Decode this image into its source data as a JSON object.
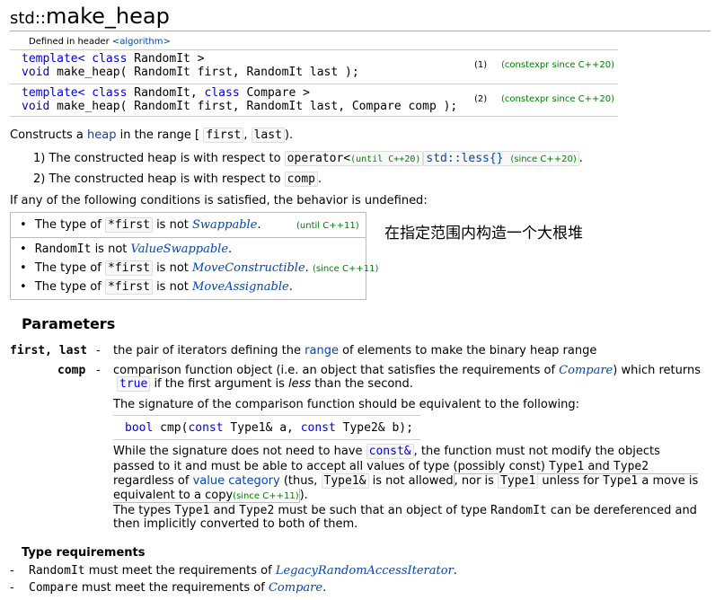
{
  "header": {
    "title_prefix": "std::",
    "title_main": "make_heap",
    "defined_in_prefix": "Defined in header ",
    "defined_in_header": "<algorithm>"
  },
  "decls": [
    {
      "tpl_kw": "template<",
      "tpl_class": "class",
      "tpl_rest": " RandomIt >",
      "ret_kw": "void",
      "sig": " make_heap( RandomIt first, RandomIt last );",
      "num": "(1)",
      "note": "(constexpr since C++20)"
    },
    {
      "tpl_kw": "template<",
      "tpl_class": "class",
      "tpl_mid": " RandomIt, ",
      "tpl_class2": "class",
      "tpl_rest": " Compare >",
      "ret_kw": "void",
      "sig": " make_heap( RandomIt first, RandomIt last, Compare comp );",
      "num": "(2)",
      "note": "(constexpr since C++20)"
    }
  ],
  "intro": {
    "prefix": "Constructs a ",
    "heap_link": "heap",
    "mid": " in the range [",
    "first": "first",
    "comma": ",",
    "last": "last",
    "suffix": ")."
  },
  "items": [
    {
      "label": "1) The constructed heap is with respect to ",
      "op": "operator<",
      "until": "(until C++20)",
      "less": "std::less{}",
      "since": "(since C++20)",
      "end": "."
    },
    {
      "label": "2) The constructed heap is with respect to ",
      "comp": "comp",
      "end": "."
    }
  ],
  "undefined_intro": "If any of the following conditions is satisfied, the behavior is undefined:",
  "conditions": {
    "c1_prefix": "The type of ",
    "c1_code": "*first",
    "c1_mid": " is not ",
    "c1_link": "Swappable",
    "c1_end": ".",
    "c1_note": "(until C++11)",
    "c2_code": "RandomIt",
    "c2_mid": " is not ",
    "c2_link": "ValueSwappable",
    "c2_end": ".",
    "c3_prefix": "The type of ",
    "c3_code": "*first",
    "c3_mid": " is not ",
    "c3_link": "MoveConstructible",
    "c3_end": ".",
    "c3_note": "(since C++11)",
    "c4_prefix": "The type of ",
    "c4_code": "*first",
    "c4_mid": " is not ",
    "c4_link": "MoveAssignable",
    "c4_end": "."
  },
  "annotation": "在指定范围内构造一个大根堆",
  "parameters": {
    "heading": "Parameters",
    "p1_name": "first, last",
    "dash": "-",
    "p1_prefix": "the pair of iterators defining the ",
    "p1_link": "range",
    "p1_suffix": " of elements to make the binary heap range",
    "p2_name": "comp",
    "p2_l1_prefix": "comparison function object (i.e. an object that satisfies the requirements of ",
    "p2_l1_link": "Compare",
    "p2_l1_suffix": ") which returns",
    "p2_l2_true": "true",
    "p2_l2_mid": " if the first argument is ",
    "p2_l2_less": "less",
    "p2_l2_end": " than the second.",
    "sig_intro": "The signature of the comparison function should be equivalent to the following:",
    "sig_kw_bool": "bool",
    "sig_cmp": " cmp(",
    "sig_kw_const1": "const",
    "sig_t1": " Type1& a, ",
    "sig_kw_const2": "const",
    "sig_t2": " Type2& b);",
    "w1_prefix": "While the signature does not need to have ",
    "w1_code": "const&",
    "w1_suffix": ", the function must not modify the objects",
    "w2_prefix": "passed to it and must be able to accept all values of type (possibly const) ",
    "w2_t1": "Type1",
    "w2_and": " and ",
    "w2_t2": "Type2",
    "w3_prefix": "regardless of ",
    "w3_link": "value category",
    "w3_thus": " (thus, ",
    "w3_code1": "Type1&",
    "w3_mid": " is not allowed",
    "w3_nor": ", nor is ",
    "w3_code2": "Type1",
    "w3_unless": " unless for ",
    "w3_t1": "Type1",
    "w3_end": " a move is",
    "w4_prefix": "equivalent to a copy",
    "w4_since": "(since C++11)",
    "w4_end": ").",
    "t1_prefix": "The types ",
    "t1_t1": "Type1",
    "t1_and": " and ",
    "t1_t2": "Type2",
    "t1_mid": " must be such that an object of type ",
    "t1_ri": "RandomIt",
    "t1_end": " can be dereferenced and",
    "t2": "then implicitly converted to both of them."
  },
  "type_requirements": {
    "heading": "Type requirements",
    "dash": "-",
    "r1_code": "RandomIt",
    "r1_mid": " must meet the requirements of ",
    "r1_link": "LegacyRandomAccessIterator",
    "r1_end": ".",
    "r2_code": "Compare",
    "r2_mid": " must meet the requirements of ",
    "r2_link": "Compare",
    "r2_end": "."
  }
}
